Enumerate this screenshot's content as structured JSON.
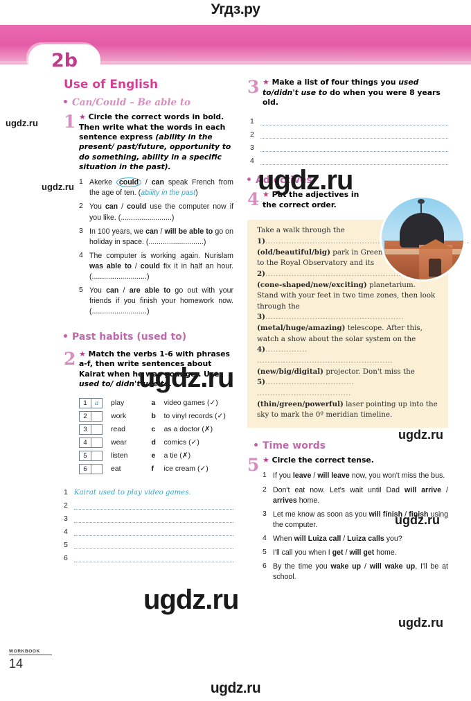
{
  "watermarks": {
    "top": "Угдз.ру",
    "bottom": "ugdz.ru",
    "small": "ugdz.ru",
    "big": "ugdz.ru"
  },
  "header": {
    "unit_tab": "2b"
  },
  "left_column": {
    "section_title": "Use of English",
    "subheadings": {
      "can_could": "Can/Could – Be able to",
      "past_habits": "Past habits (used to)"
    },
    "exercise1": {
      "number": "1",
      "star": "★",
      "instruction_1": "Circle the correct words in bold.",
      "instruction_2": "Then write what the words in each",
      "instruction_3": "sentence express ",
      "instruction_italic": "(ability in the present/ past/future, opportunity to do something, ability in a specific situation in the past).",
      "items": [
        {
          "n": "1",
          "pre": "Akerke ",
          "circled": "could",
          "mid": " / ",
          "bold": "can",
          "post": " speak French from the age of ten. (",
          "hint": "ability in the past",
          "tail": ")"
        },
        {
          "n": "2",
          "pre": "You ",
          "bold1": "can",
          "mid": " / ",
          "bold2": "could",
          "post": " use the computer now if you like. (.........................)"
        },
        {
          "n": "3",
          "pre": "In 100 years, we ",
          "bold1": "can",
          "mid": " / ",
          "bold2": "will be able to",
          "post": " go on holiday in space. (...........................)"
        },
        {
          "n": "4",
          "pre": "The computer is working again. Nurislam ",
          "bold1": "was able to",
          "mid": " / ",
          "bold2": "could",
          "post": " fix it in half an hour. (...........................)"
        },
        {
          "n": "5",
          "pre": "You ",
          "bold1": "can",
          "mid": " / ",
          "bold2": "are able to",
          "post": " go out with your friends if you finish your homework now. (...........................)"
        }
      ]
    },
    "exercise2": {
      "number": "2",
      "star": "★",
      "instruction": "Match the verbs 1-6 with phrases a-f, then write sentences about Kairat when he was younger. Use ",
      "instruction_italic": "used to/ didn't use to.",
      "verbs": [
        {
          "num": "1",
          "answer": "a",
          "verb": "play"
        },
        {
          "num": "2",
          "answer": "",
          "verb": "work"
        },
        {
          "num": "3",
          "answer": "",
          "verb": "read"
        },
        {
          "num": "4",
          "answer": "",
          "verb": "wear"
        },
        {
          "num": "5",
          "answer": "",
          "verb": "listen"
        },
        {
          "num": "6",
          "answer": "",
          "verb": "eat"
        }
      ],
      "phrases": [
        {
          "letter": "a",
          "text": "video games (✓)"
        },
        {
          "letter": "b",
          "text": "to vinyl records (✓)"
        },
        {
          "letter": "c",
          "text": "as a doctor (✗)"
        },
        {
          "letter": "d",
          "text": "comics (✓)"
        },
        {
          "letter": "e",
          "text": "a tie (✗)"
        },
        {
          "letter": "f",
          "text": "ice cream (✓)"
        }
      ],
      "answer_lines": [
        {
          "n": "1",
          "answer": "Kairat used to play video games."
        },
        {
          "n": "2",
          "answer": ""
        },
        {
          "n": "3",
          "answer": ""
        },
        {
          "n": "4",
          "answer": ""
        },
        {
          "n": "5",
          "answer": ""
        },
        {
          "n": "6",
          "answer": ""
        }
      ]
    }
  },
  "right_column": {
    "exercise3": {
      "number": "3",
      "star": "★",
      "instruction_pre": "Make a list of four things you ",
      "instruction_italic": "used to/didn't use to",
      "instruction_post": " do when you were 8 years old.",
      "answer_lines": [
        {
          "n": "1"
        },
        {
          "n": "2"
        },
        {
          "n": "3"
        },
        {
          "n": "4"
        }
      ]
    },
    "subheadings": {
      "adjectives": "Adjectives",
      "time_words": "Time words"
    },
    "exercise4": {
      "number": "4",
      "star": "★",
      "instruction": "Put the adjectives in the correct order.",
      "passage": {
        "s1": "Take a walk through the",
        "gap1_label": "1)",
        "gap1_dots": "..................................................",
        "gap1b_dots": "............................",
        "gap1_options": "(old/beautiful/big)",
        "s2": " park in Greenwich, London to the Royal Observatory and its ",
        "gap2_label": "2)",
        "gap2_dots": "................................................................",
        "gap2_options": "(cone-shaped/new/exciting)",
        "s3": " planetarium. Stand with your feet in two time zones, then look through the ",
        "gap3_label": "3)",
        "gap3_dots": ".....................................................",
        "gap3_options": "(metal/huge/amazing)",
        "s4": " telescope. After this, watch a show about the solar system on the ",
        "gap4_label": "4)",
        "gap4_dots": "................ ....................................................",
        "gap4_options": "(new/big/digital)",
        "s5": " projector. Don't miss the ",
        "gap5_label": "5)",
        "gap5_dots": ".................................. ....................................",
        "gap5_options": "(thin/green/powerful)",
        "s6": " laser pointing up into the sky to mark the 0º meridian timeline."
      }
    },
    "exercise5": {
      "number": "5",
      "star": "★",
      "instruction": "Circle the correct tense.",
      "items": [
        {
          "n": "1",
          "pre": "If you ",
          "b1": "leave",
          "mid": " / ",
          "b2": "will leave",
          "post": " now, you won't miss the bus."
        },
        {
          "n": "2",
          "pre": "Don't eat now. Let's wait until Dad ",
          "b1": "will arrive",
          "mid": " / ",
          "b2": "arrives",
          "post": " home."
        },
        {
          "n": "3",
          "pre": "Let me know as soon as you ",
          "b1": "will finish",
          "mid": " / ",
          "b2": "finish",
          "post": " using the computer."
        },
        {
          "n": "4",
          "pre": "When ",
          "b1": "will Luiza call",
          "mid": " / ",
          "b2": "Luiza calls",
          "post": " you?"
        },
        {
          "n": "5",
          "pre": "I'll call you when I ",
          "b1": "get",
          "mid": " / ",
          "b2": "will get",
          "post": " home."
        },
        {
          "n": "6",
          "pre": "By the time you ",
          "b1": "wake up",
          "mid": " / ",
          "b2": "will wake up",
          "post": ", I'll be at school."
        }
      ]
    }
  },
  "footer": {
    "label": "WORKBOOK",
    "page_number": "14"
  },
  "colors": {
    "band_pink": "#e45ba6",
    "title_pink": "#d43f95",
    "sub_pink": "#d98ec0",
    "hint_blue": "#3da6c9",
    "yellow_box": "#fbf0d6"
  }
}
